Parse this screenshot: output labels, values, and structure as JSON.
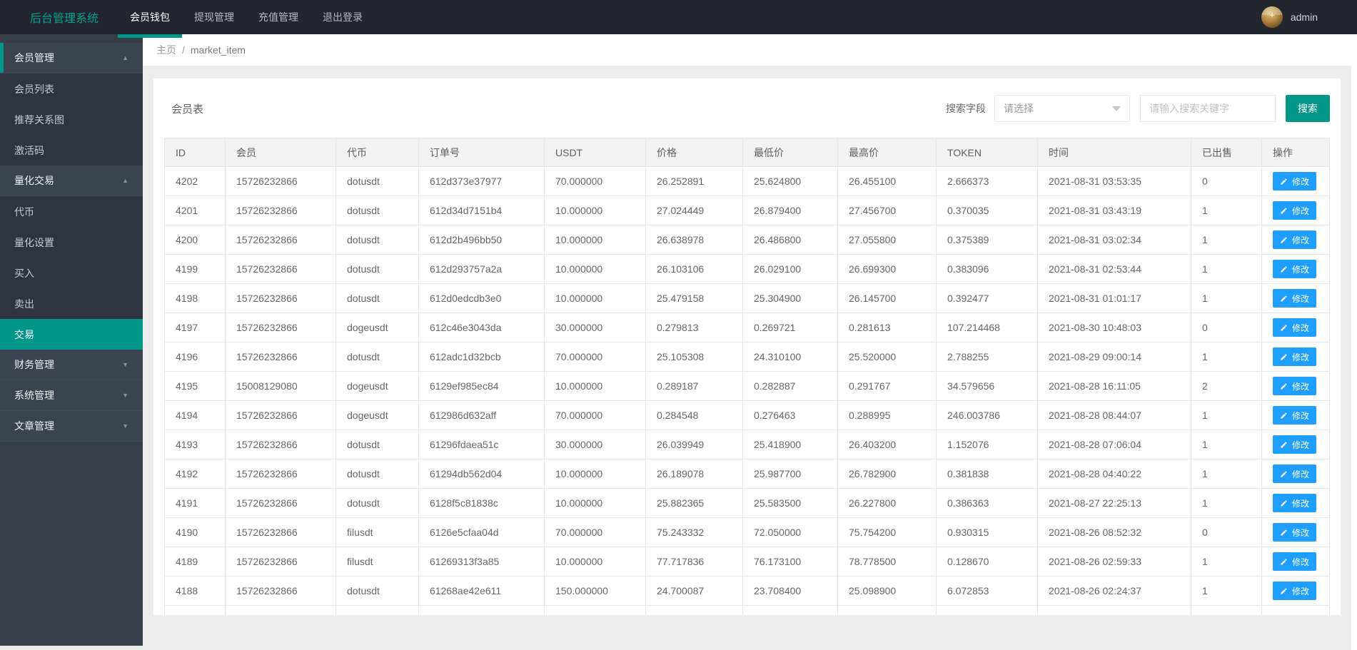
{
  "topbar": {
    "logo": "后台管理系统",
    "username": "admin",
    "tabs": [
      {
        "label": "会员钱包",
        "active": true
      },
      {
        "label": "提现管理",
        "active": false
      },
      {
        "label": "充值管理",
        "active": false
      },
      {
        "label": "退出登录",
        "active": false
      }
    ]
  },
  "sidebar": {
    "items": [
      {
        "label": "会员管理",
        "type": "group",
        "expanded": true,
        "indicator": true,
        "active": false
      },
      {
        "label": "会员列表",
        "type": "child",
        "active": false
      },
      {
        "label": "推荐关系图",
        "type": "child",
        "active": false
      },
      {
        "label": "激活码",
        "type": "child",
        "active": false
      },
      {
        "label": "量化交易",
        "type": "group",
        "expanded": true,
        "indicator": false,
        "active": false
      },
      {
        "label": "代币",
        "type": "child",
        "active": false
      },
      {
        "label": "量化设置",
        "type": "child",
        "active": false
      },
      {
        "label": "买入",
        "type": "child",
        "active": false
      },
      {
        "label": "卖出",
        "type": "child",
        "active": false
      },
      {
        "label": "交易",
        "type": "child",
        "active": true
      },
      {
        "label": "财务管理",
        "type": "group",
        "expanded": false,
        "indicator": false,
        "active": false
      },
      {
        "label": "系统管理",
        "type": "group",
        "expanded": false,
        "indicator": false,
        "active": false
      },
      {
        "label": "文章管理",
        "type": "group",
        "expanded": false,
        "indicator": false,
        "active": false
      }
    ]
  },
  "breadcrumb": {
    "home": "主页",
    "separator": "/",
    "current": "market_item"
  },
  "panel": {
    "title": "会员表",
    "search_label": "搜索字段",
    "select_placeholder": "请选择",
    "input_placeholder": "请输入搜索关键字",
    "search_button": "搜索"
  },
  "table": {
    "columns": [
      "ID",
      "会员",
      "代币",
      "订单号",
      "USDT",
      "价格",
      "最低价",
      "最高价",
      "TOKEN",
      "时间",
      "已出售",
      "操作"
    ],
    "edit_label": "修改",
    "rows": [
      [
        "4202",
        "15726232866",
        "dotusdt",
        "612d373e37977",
        "70.000000",
        "26.252891",
        "25.624800",
        "26.455100",
        "2.666373",
        "2021-08-31 03:53:35",
        "0"
      ],
      [
        "4201",
        "15726232866",
        "dotusdt",
        "612d34d7151b4",
        "10.000000",
        "27.024449",
        "26.879400",
        "27.456700",
        "0.370035",
        "2021-08-31 03:43:19",
        "1"
      ],
      [
        "4200",
        "15726232866",
        "dotusdt",
        "612d2b496bb50",
        "10.000000",
        "26.638978",
        "26.486800",
        "27.055800",
        "0.375389",
        "2021-08-31 03:02:34",
        "1"
      ],
      [
        "4199",
        "15726232866",
        "dotusdt",
        "612d293757a2a",
        "10.000000",
        "26.103106",
        "26.029100",
        "26.699300",
        "0.383096",
        "2021-08-31 02:53:44",
        "1"
      ],
      [
        "4198",
        "15726232866",
        "dotusdt",
        "612d0edcdb3e0",
        "10.000000",
        "25.479158",
        "25.304900",
        "26.145700",
        "0.392477",
        "2021-08-31 01:01:17",
        "1"
      ],
      [
        "4197",
        "15726232866",
        "dogeusdt",
        "612c46e3043da",
        "30.000000",
        "0.279813",
        "0.269721",
        "0.281613",
        "107.214468",
        "2021-08-30 10:48:03",
        "0"
      ],
      [
        "4196",
        "15726232866",
        "dotusdt",
        "612adc1d32bcb",
        "70.000000",
        "25.105308",
        "24.310100",
        "25.520000",
        "2.788255",
        "2021-08-29 09:00:14",
        "1"
      ],
      [
        "4195",
        "15008129080",
        "dogeusdt",
        "6129ef985ec84",
        "10.000000",
        "0.289187",
        "0.282887",
        "0.291767",
        "34.579656",
        "2021-08-28 16:11:05",
        "2"
      ],
      [
        "4194",
        "15726232866",
        "dogeusdt",
        "612986d632aff",
        "70.000000",
        "0.284548",
        "0.276463",
        "0.288995",
        "246.003786",
        "2021-08-28 08:44:07",
        "1"
      ],
      [
        "4193",
        "15726232866",
        "dotusdt",
        "61296fdaea51c",
        "30.000000",
        "26.039949",
        "25.418900",
        "26.403200",
        "1.152076",
        "2021-08-28 07:06:04",
        "1"
      ],
      [
        "4192",
        "15726232866",
        "dotusdt",
        "61294db562d04",
        "10.000000",
        "26.189078",
        "25.987700",
        "26.782900",
        "0.381838",
        "2021-08-28 04:40:22",
        "1"
      ],
      [
        "4191",
        "15726232866",
        "dotusdt",
        "6128f5c81838c",
        "10.000000",
        "25.882365",
        "25.583500",
        "26.227800",
        "0.386363",
        "2021-08-27 22:25:13",
        "1"
      ],
      [
        "4190",
        "15726232866",
        "filusdt",
        "6126e5cfaa04d",
        "70.000000",
        "75.243332",
        "72.050000",
        "75.754200",
        "0.930315",
        "2021-08-26 08:52:32",
        "0"
      ],
      [
        "4189",
        "15726232866",
        "filusdt",
        "61269313f3a85",
        "10.000000",
        "77.717836",
        "76.173100",
        "78.778500",
        "0.128670",
        "2021-08-26 02:59:33",
        "1"
      ],
      [
        "4188",
        "15726232866",
        "dotusdt",
        "61268ae42e611",
        "150.000000",
        "24.700087",
        "23.708400",
        "25.098900",
        "6.072853",
        "2021-08-26 02:24:37",
        "1"
      ]
    ]
  },
  "colors": {
    "theme_teal": "#009688",
    "edit_button_blue": "#1e9fff",
    "topbar_bg": "#23262e",
    "sidebar_bg": "#373d49",
    "body_bg": "#ececec",
    "logo_teal": "#00a392"
  }
}
